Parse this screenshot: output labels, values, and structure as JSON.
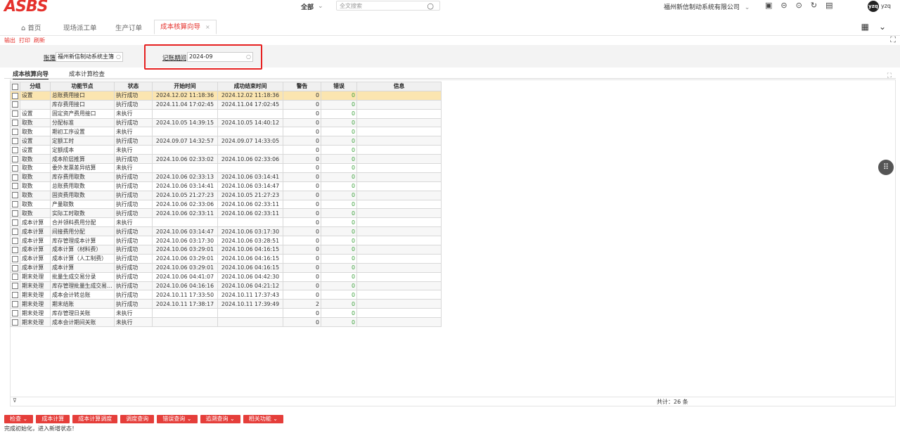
{
  "app": {
    "logo": "ASBS"
  },
  "search": {
    "scope": "全部",
    "scope_caret": "⌄",
    "placeholder": "全文搜索",
    "icon": "search-icon"
  },
  "header": {
    "company": "福州新信制动系统有限公司",
    "company_caret": "⌄",
    "avatar": "yzq",
    "username": "yzq"
  },
  "tabs": [
    {
      "label": "首页",
      "icon": "home-icon"
    },
    {
      "label": "现场派工单"
    },
    {
      "label": "生产订单"
    },
    {
      "label": "成本核算向导",
      "active": true,
      "close": "×"
    }
  ],
  "actions": {
    "export": "输出",
    "print": "打印",
    "refresh": "刷新"
  },
  "filters": {
    "account_label": "账簿",
    "account_value": "福州新信制动系统主簿",
    "period_label": "记账期间",
    "period_value": "2024-09"
  },
  "content_tabs": [
    "成本核算向导",
    "成本计算检查"
  ],
  "grid": {
    "columns": [
      "分组",
      "功能节点",
      "状态",
      "开始时间",
      "成功结束时间",
      "警告",
      "错误",
      "信息"
    ],
    "rows": [
      [
        "设置",
        "总账费用接口",
        "执行成功",
        "2024.12.02 11:18:36",
        "2024.12.02 11:18:36",
        "0",
        "0",
        ""
      ],
      [
        "",
        "库存费用接口",
        "执行成功",
        "2024.11.04 17:02:45",
        "2024.11.04 17:02:45",
        "0",
        "0",
        ""
      ],
      [
        "设置",
        "固定资产费用接口",
        "未执行",
        "",
        "",
        "0",
        "0",
        ""
      ],
      [
        "取数",
        "分配标准",
        "执行成功",
        "2024.10.05 14:39:15",
        "2024.10.05 14:40:12",
        "0",
        "0",
        ""
      ],
      [
        "取数",
        "期初工序设置",
        "未执行",
        "",
        "",
        "0",
        "0",
        ""
      ],
      [
        "设置",
        "定额工时",
        "执行成功",
        "2024.09.07 14:32:57",
        "2024.09.07 14:33:05",
        "0",
        "0",
        ""
      ],
      [
        "设置",
        "定额成本",
        "未执行",
        "",
        "",
        "0",
        "0",
        ""
      ],
      [
        "取数",
        "成本阶层推算",
        "执行成功",
        "2024.10.06 02:33:02",
        "2024.10.06 02:33:06",
        "0",
        "0",
        ""
      ],
      [
        "取数",
        "委外发票差异结算",
        "未执行",
        "",
        "",
        "0",
        "0",
        ""
      ],
      [
        "取数",
        "库存费用取数",
        "执行成功",
        "2024.10.06 02:33:13",
        "2024.10.06 03:14:41",
        "0",
        "0",
        ""
      ],
      [
        "取数",
        "总账费用取数",
        "执行成功",
        "2024.10.06 03:14:41",
        "2024.10.06 03:14:47",
        "0",
        "0",
        ""
      ],
      [
        "取数",
        "固资费用取数",
        "执行成功",
        "2024.10.05 21:27:23",
        "2024.10.05 21:27:23",
        "0",
        "0",
        ""
      ],
      [
        "取数",
        "产量取数",
        "执行成功",
        "2024.10.06 02:33:06",
        "2024.10.06 02:33:11",
        "0",
        "0",
        ""
      ],
      [
        "取数",
        "实际工时取数",
        "执行成功",
        "2024.10.06 02:33:11",
        "2024.10.06 02:33:11",
        "0",
        "0",
        ""
      ],
      [
        "成本计算",
        "合并领料费用分配",
        "未执行",
        "",
        "",
        "0",
        "0",
        ""
      ],
      [
        "成本计算",
        "间接费用分配",
        "执行成功",
        "2024.10.06 03:14:47",
        "2024.10.06 03:17:30",
        "0",
        "0",
        ""
      ],
      [
        "成本计算",
        "库存管理成本计算",
        "执行成功",
        "2024.10.06 03:17:30",
        "2024.10.06 03:28:51",
        "0",
        "0",
        ""
      ],
      [
        "成本计算",
        "成本计算（材料费）",
        "执行成功",
        "2024.10.06 03:29:01",
        "2024.10.06 04:16:15",
        "0",
        "0",
        ""
      ],
      [
        "成本计算",
        "成本计算（人工制费）",
        "执行成功",
        "2024.10.06 03:29:01",
        "2024.10.06 04:16:15",
        "0",
        "0",
        ""
      ],
      [
        "成本计算",
        "成本计算",
        "执行成功",
        "2024.10.06 03:29:01",
        "2024.10.06 04:16:15",
        "0",
        "0",
        ""
      ],
      [
        "期末处理",
        "批量生成交易分录",
        "执行成功",
        "2024.10.06 04:41:07",
        "2024.10.06 04:42:30",
        "0",
        "0",
        ""
      ],
      [
        "期末处理",
        "库存管理批量生成交易…",
        "执行成功",
        "2024.10.06 04:16:16",
        "2024.10.06 04:21:12",
        "0",
        "0",
        ""
      ],
      [
        "期末处理",
        "成本会计转总账",
        "执行成功",
        "2024.10.11 17:33:50",
        "2024.10.11 17:37:43",
        "0",
        "0",
        ""
      ],
      [
        "期末处理",
        "期末结账",
        "执行成功",
        "2024.10.11 17:38:17",
        "2024.10.11 17:39:49",
        "2",
        "0",
        ""
      ],
      [
        "期末处理",
        "库存管理日关账",
        "未执行",
        "",
        "",
        "0",
        "0",
        ""
      ],
      [
        "期末处理",
        "成本会计期间关账",
        "未执行",
        "",
        "",
        "0",
        "0",
        ""
      ]
    ],
    "total": "共计：26 条"
  },
  "buttons": [
    {
      "label": "检查 ⌄"
    },
    {
      "label": "成本计算"
    },
    {
      "label": "成本计算调度"
    },
    {
      "label": "调度查询"
    },
    {
      "label": "错误查询 ⌄"
    },
    {
      "label": "追溯查询 ⌄"
    },
    {
      "label": "相关功能 ⌄"
    }
  ],
  "status": "完成初始化，进入新增状态！",
  "colors": {
    "brand": "#e5322d",
    "success": "#3aa03a",
    "selected_row": "#fbe5b0"
  }
}
